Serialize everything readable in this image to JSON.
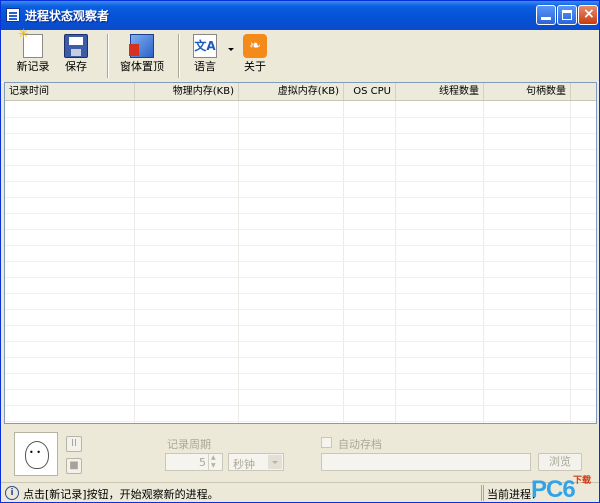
{
  "window": {
    "title": "进程状态观察者"
  },
  "toolbar": {
    "new_record": "新记录",
    "save": "保存",
    "window_topmost": "窗体置顶",
    "language": "语言",
    "about": "关于",
    "lang_icon_glyph": "文A",
    "about_icon_glyph": "❧"
  },
  "table": {
    "columns": [
      "记录时间",
      "物理内存(KB)",
      "虚拟内存(KB)",
      "OS CPU",
      "线程数量",
      "句柄数量"
    ],
    "rows": []
  },
  "bottom": {
    "period_label": "记录周期",
    "period_value": "5",
    "unit_value": "秒钟",
    "autosave_label": "自动存档",
    "autosave_checked": false,
    "path_value": "",
    "browse": "浏览",
    "pause_glyph": "II",
    "stop_glyph": "■"
  },
  "status": {
    "icon_glyph": "i",
    "message": "点击[新记录]按钮，开始观察新的进程。",
    "right_text": "当前进程："
  },
  "watermark": {
    "main": "PC6",
    "sub": "下载"
  },
  "colors": {
    "titlebar": "#0552d6",
    "face": "#ece9d8",
    "grid_border": "#7f9db9",
    "disabled": "#aca899"
  }
}
